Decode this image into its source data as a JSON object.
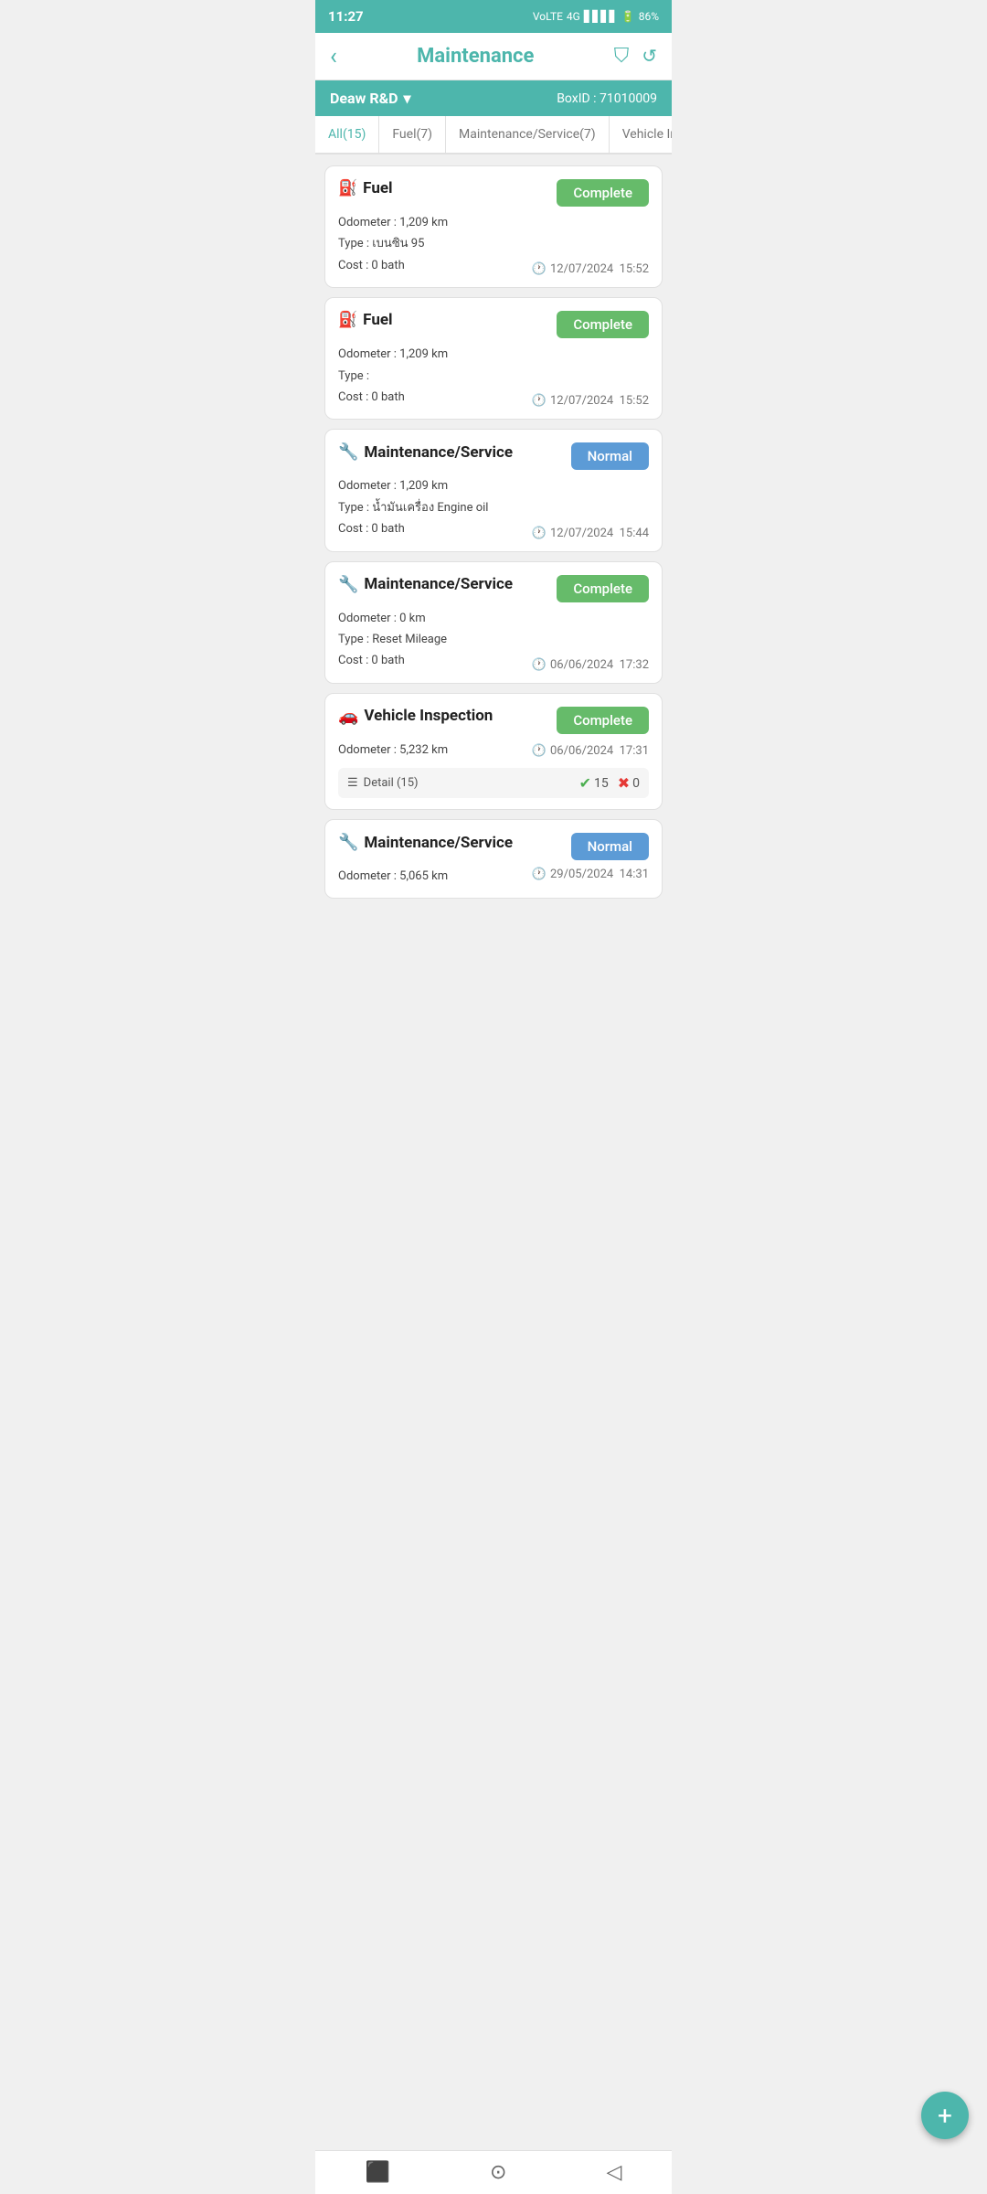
{
  "statusBar": {
    "time": "11:27",
    "battery": "86%"
  },
  "header": {
    "title": "Maintenance",
    "backIcon": "‹",
    "filterIcon": "⛉",
    "refreshIcon": "↺"
  },
  "branchBar": {
    "branchName": "Deaw R&D",
    "dropdownIcon": "▾",
    "boxIdLabel": "BoxID :",
    "boxIdValue": "71010009"
  },
  "tabs": [
    {
      "label": "All(15)",
      "active": true
    },
    {
      "label": "Fuel(7)",
      "active": false
    },
    {
      "label": "Maintenance/Service(7)",
      "active": false
    },
    {
      "label": "Vehicle Inspection(",
      "active": false
    }
  ],
  "cards": [
    {
      "id": 1,
      "type": "fuel",
      "iconLabel": "fuel-pump",
      "icon": "⛽",
      "title": "Fuel",
      "badge": "Complete",
      "badgeType": "complete",
      "odometer": "Odometer : 1,209 km",
      "type_label": "Type : เบนซิน 95",
      "cost": "Cost : 0 bath",
      "datetime": "12/07/2024  15:52"
    },
    {
      "id": 2,
      "type": "fuel",
      "iconLabel": "fuel-pump",
      "icon": "⛽",
      "title": "Fuel",
      "badge": "Complete",
      "badgeType": "complete",
      "odometer": "Odometer : 1,209 km",
      "type_label": "Type :",
      "cost": "Cost : 0 bath",
      "datetime": "12/07/2024  15:52"
    },
    {
      "id": 3,
      "type": "maintenance",
      "iconLabel": "wrench",
      "icon": "🔧",
      "title": "Maintenance/Service",
      "badge": "Normal",
      "badgeType": "normal",
      "odometer": "Odometer : 1,209 km",
      "type_label": "Type : น้ำมันเครื่อง Engine oil",
      "cost": "Cost : 0 bath",
      "datetime": "12/07/2024  15:44"
    },
    {
      "id": 4,
      "type": "maintenance",
      "iconLabel": "wrench",
      "icon": "🔧",
      "title": "Maintenance/Service",
      "badge": "Complete",
      "badgeType": "complete",
      "odometer": "Odometer : 0 km",
      "type_label": "Type : Reset Mileage",
      "cost": "Cost : 0 bath",
      "datetime": "06/06/2024  17:32"
    },
    {
      "id": 5,
      "type": "vehicle_inspection",
      "iconLabel": "car",
      "icon": "🚗",
      "title": "Vehicle Inspection",
      "badge": "Complete",
      "badgeType": "complete",
      "odometer": "Odometer : 5,232 km",
      "datetime": "06/06/2024  17:31",
      "hasDetail": true,
      "detailLabel": "Detail (15)",
      "countOk": 15,
      "countFail": 0
    },
    {
      "id": 6,
      "type": "maintenance",
      "iconLabel": "wrench",
      "icon": "🔧",
      "title": "Maintenance/Service",
      "badge": "Normal",
      "badgeType": "normal",
      "odometer": "Odometer : 5,065 km",
      "type_label": "",
      "cost": "",
      "datetime": "29/05/2024  14:31",
      "truncated": true
    }
  ],
  "fab": {
    "label": "+"
  }
}
